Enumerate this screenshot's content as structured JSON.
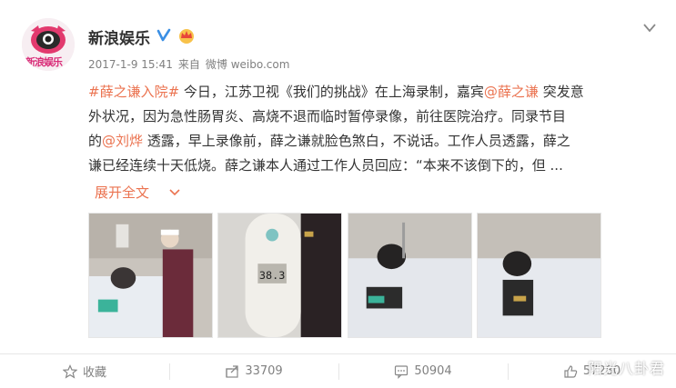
{
  "account": {
    "name": "新浪娱乐",
    "logo_text": "新浪娱乐",
    "date": "2017-1-9 15:41",
    "source_prefix": "来自",
    "source": "微博 weibo.com"
  },
  "post": {
    "hashtag": "#薛之谦入院#",
    "line1_a": " 今日，江苏卫视《我们的挑战》在上海录制，嘉宾",
    "mention1": "@薛之谦",
    "line1_b": " 突发意",
    "line2": "外状况，因为急性肠胃炎、高烧不退而临时暂停录像，前往医院治疗。同录节目",
    "line3_a": "的",
    "mention2": "@刘烨",
    "line3_b": " 透露，早上录像前，薛之谦就脸色煞白，不说话。工作人员透露，薛之",
    "line4": "谦已经连续十天低烧。薛之谦本人通过工作人员回应：“本来不该倒下的，但 ...",
    "expand_label": "展开全文"
  },
  "photos": [
    {
      "label": "hospital-scene-nurse"
    },
    {
      "label": "thermometer-reading",
      "reading": "38.3"
    },
    {
      "label": "patient-in-bed"
    },
    {
      "label": "patient-in-bed-2"
    }
  ],
  "footer": {
    "favorite_label": "收藏",
    "share_count": "33709",
    "comment_count": "50904",
    "like_count": "57280"
  },
  "watermark": "阳光八卦君",
  "colors": {
    "accent": "#eb7350",
    "text": "#333333",
    "meta": "#808080"
  }
}
